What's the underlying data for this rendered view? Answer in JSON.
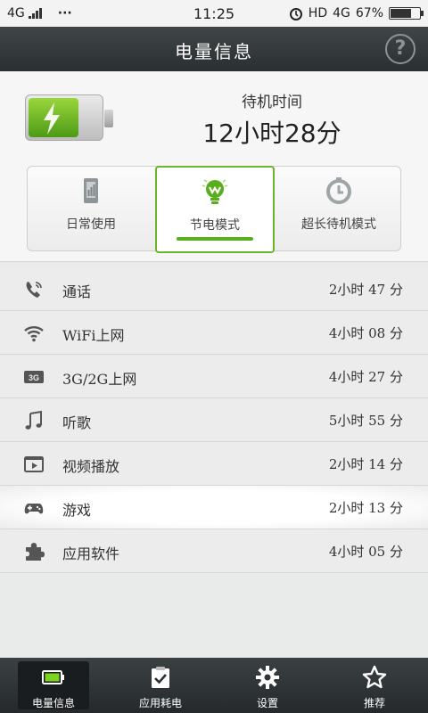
{
  "status_bar": {
    "network_left": "4G",
    "dots": "···",
    "time": "11:25",
    "hd": "HD",
    "network_right": "4G",
    "battery_percent": "67%",
    "battery_level": 0.67
  },
  "header": {
    "title": "电量信息",
    "help_label": "?"
  },
  "summary": {
    "standby_label": "待机时间",
    "standby_value": "12小时28分"
  },
  "modes": [
    {
      "label": "日常使用",
      "icon": "phone-icon",
      "selected": false
    },
    {
      "label": "节电模式",
      "icon": "lightbulb-icon",
      "selected": true
    },
    {
      "label": "超长待机模式",
      "icon": "timer-icon",
      "selected": false
    }
  ],
  "usage_list": [
    {
      "name": "通话",
      "time": "2小时 47 分",
      "icon": "call-icon"
    },
    {
      "name": "WiFi上网",
      "time": "4小时 08 分",
      "icon": "wifi-icon"
    },
    {
      "name": "3G/2G上网",
      "time": "4小时 27 分",
      "icon": "3g-icon"
    },
    {
      "name": "听歌",
      "time": "5小时 55 分",
      "icon": "music-icon"
    },
    {
      "name": "视频播放",
      "time": "2小时 14 分",
      "icon": "video-icon"
    },
    {
      "name": "游戏",
      "time": "2小时 13 分",
      "icon": "gamepad-icon"
    },
    {
      "name": "应用软件",
      "time": "4小时 05 分",
      "icon": "puzzle-icon"
    }
  ],
  "bottom_nav": [
    {
      "label": "电量信息",
      "icon": "battery-icon",
      "selected": true
    },
    {
      "label": "应用耗电",
      "icon": "clipboard-check-icon",
      "selected": false
    },
    {
      "label": "设置",
      "icon": "gear-icon",
      "selected": false
    },
    {
      "label": "推荐",
      "icon": "star-icon",
      "selected": false
    }
  ],
  "colors": {
    "accent_green": "#5aae1c",
    "header_bg": "#2f3436"
  }
}
